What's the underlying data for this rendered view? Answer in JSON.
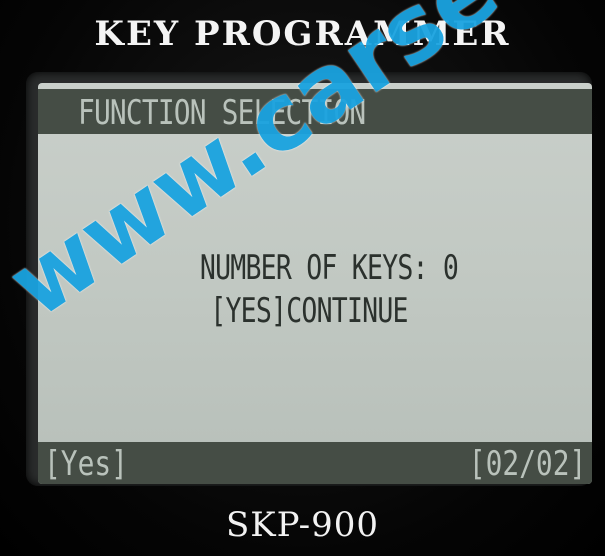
{
  "device": {
    "brand_title": "KEY PROGRAMMER",
    "model": "SKP-900"
  },
  "screen": {
    "header": "FUNCTION SELECTION",
    "lines": [
      "NUMBER OF KEYS: 0",
      "[YES]CONTINUE"
    ],
    "footer": {
      "left": "[Yes]",
      "right": "[02/02]"
    }
  },
  "watermark": {
    "text": "www.carsets.c"
  },
  "colors": {
    "lcd_background": "#c2c9c3",
    "lcd_bar": "#454d45",
    "watermark": "#1aa3e0"
  }
}
